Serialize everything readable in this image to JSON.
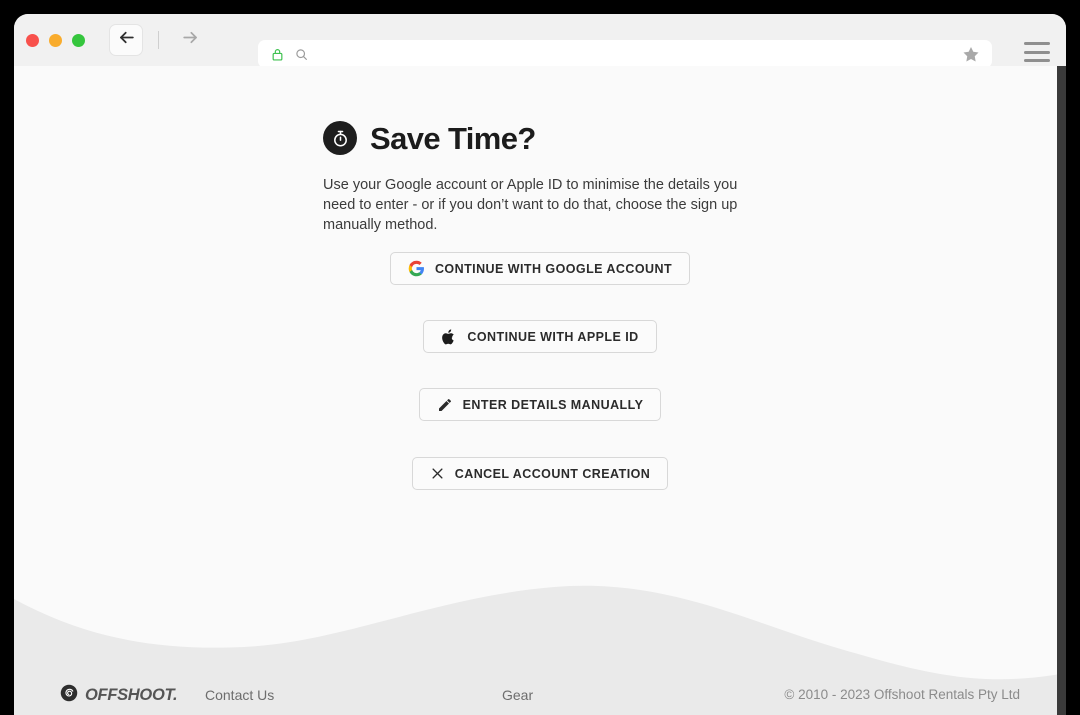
{
  "browser": {
    "traffic_lights": [
      "close",
      "minimize",
      "maximize"
    ],
    "back_icon": "arrow-left-icon",
    "forward_icon": "arrow-right-icon",
    "lock_icon": "padlock-icon",
    "search_icon": "search-icon",
    "bookmark_icon": "star-icon",
    "menu_icon": "hamburger-menu-icon",
    "url_value": "",
    "url_placeholder": ""
  },
  "page": {
    "badge_icon": "stopwatch-icon",
    "title": "Save Time?",
    "blurb": "Use your Google account or Apple ID to minimise the details you need to enter - or if you don’t want to do that, choose the sign up manually method.",
    "buttons": [
      {
        "id": "google",
        "label": "CONTINUE WITH GOOGLE ACCOUNT",
        "icon": "google-logo-icon"
      },
      {
        "id": "apple",
        "label": "CONTINUE WITH APPLE ID",
        "icon": "apple-logo-icon"
      },
      {
        "id": "manual",
        "label": "ENTER DETAILS MANUALLY",
        "icon": "pencil-icon"
      },
      {
        "id": "cancel",
        "label": "CANCEL ACCOUNT CREATION",
        "icon": "close-x-icon"
      }
    ]
  },
  "footer": {
    "logo_icon": "offshoot-spiral-icon",
    "brand": "OFFSHOOT.",
    "contact_label": "Contact Us",
    "gear_label": "Gear",
    "copyright": "© 2010 - 2023 Offshoot Rentals Pty Ltd"
  },
  "colors": {
    "page_bg": "#fafafa",
    "wave": "#eaeaea",
    "toolbar_bg": "#f1f1f1",
    "badge_bg": "#1e1e1e",
    "lock_green": "#3ec14f",
    "traffic_red": "#f8514c",
    "traffic_yellow": "#f9ac2d",
    "traffic_green": "#35c63d"
  }
}
